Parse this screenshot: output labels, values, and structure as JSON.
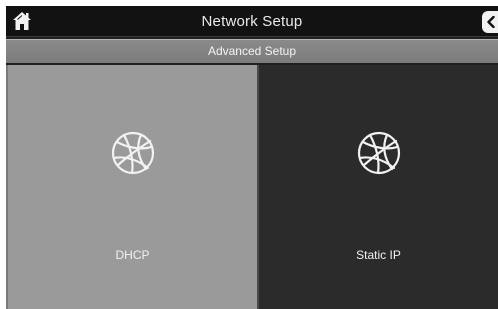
{
  "header": {
    "title": "Network Setup",
    "home_icon": "home-icon",
    "back_icon": "chevron-left-icon"
  },
  "subheader": {
    "label": "Advanced Setup"
  },
  "options": [
    {
      "label": "DHCP",
      "icon": "globe-icon",
      "selected": true
    },
    {
      "label": "Static IP",
      "icon": "globe-icon",
      "selected": false
    }
  ],
  "colors": {
    "selected_tile": "#9a9a9a",
    "unselected_tile": "#2b2b2b",
    "header_bg": "#121212",
    "subheader_bg": "#858585"
  }
}
